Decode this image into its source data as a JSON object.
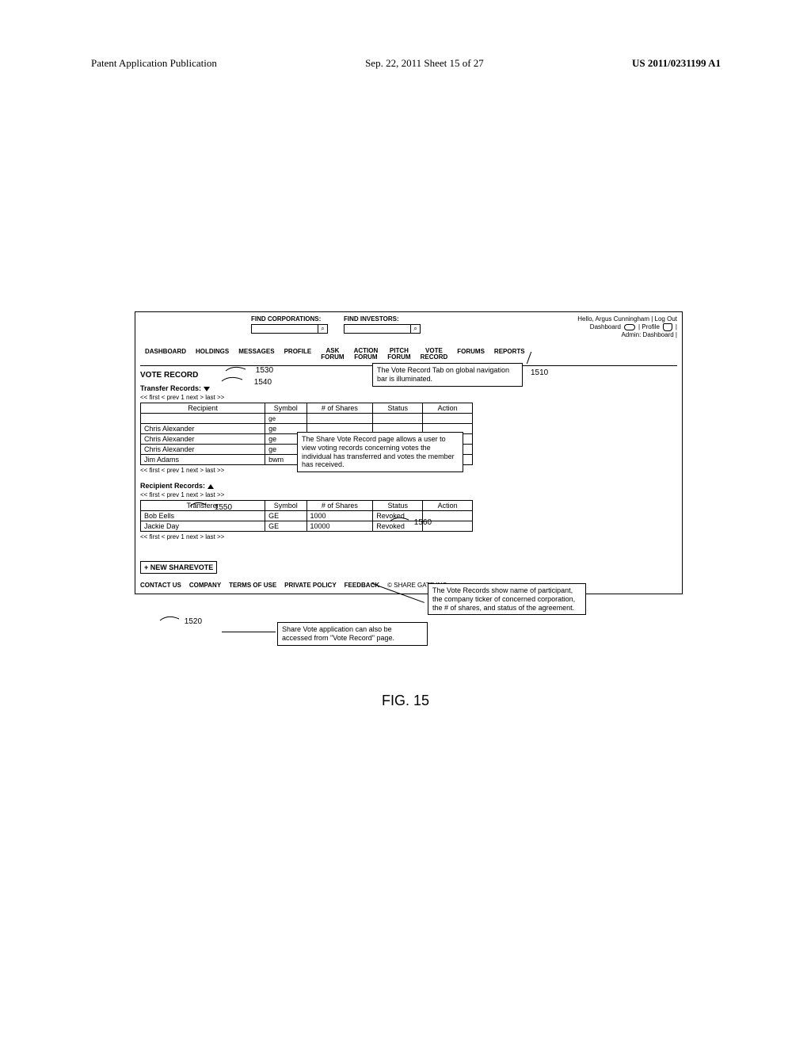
{
  "page_header": {
    "left": "Patent Application Publication",
    "mid": "Sep. 22, 2011  Sheet 15 of 27",
    "right": "US 2011/0231199 A1"
  },
  "search": {
    "corp_label": "FIND CORPORATIONS:",
    "inv_label": "FIND INVESTORS:",
    "placeholder": ""
  },
  "hello": {
    "line1": "Hello, Argus Cunningham | Log Out",
    "dash": "Dashboard",
    "profile": "| Profile",
    "admin": "Admin: Dashboard |"
  },
  "tabs": {
    "dashboard": "DASHBOARD",
    "holdings": "HOLDINGS",
    "messages": "MESSAGES",
    "profile": "PROFILE",
    "ask1": "ASK",
    "ask2": "FORUM",
    "action1": "ACTION",
    "action2": "FORUM",
    "pitch1": "PITCH",
    "pitch2": "FORUM",
    "vote1": "VOTE",
    "vote2": "RECORD",
    "forums": "FORUMS",
    "reports": "REPORTS"
  },
  "sections": {
    "title": "VOTE RECORD",
    "transfer": "Transfer Records:",
    "recipient": "Recipient Records:"
  },
  "pager": {
    "text": "<< first  < prev   1   next >   last >>"
  },
  "table1": {
    "headers": {
      "a": "Recipient",
      "b": "Symbol",
      "c": "# of Shares",
      "d": "Status",
      "e": "Action"
    },
    "filter_symbol": "ge",
    "rows": [
      {
        "a": "Chris Alexander",
        "b": "ge"
      },
      {
        "a": "Chris Alexander",
        "b": "ge"
      },
      {
        "a": "Chris Alexander",
        "b": "ge"
      },
      {
        "a": "Jim Adams",
        "b": "bwm"
      }
    ]
  },
  "table2": {
    "headers": {
      "a": "Transferer",
      "b": "Symbol",
      "c": "# of Shares",
      "d": "Status",
      "e": "Action"
    },
    "rows": [
      {
        "a": "Bob Eells",
        "b": "GE",
        "c": "1000",
        "d": "Revoked",
        "e": ""
      },
      {
        "a": "Jackie Day",
        "b": "GE",
        "c": "10000",
        "d": "Revoked",
        "e": ""
      }
    ]
  },
  "new_sharevote": "+ NEW SHAREVOTE",
  "footer": {
    "a": "CONTACT US",
    "b": "COMPANY",
    "c": "TERMS OF USE",
    "d": "PRIVATE POLICY",
    "e": "FEEDBACK",
    "copy": "© SHARE GATE INC."
  },
  "callouts": {
    "c1": "The Vote Record Tab on global navigation bar is illuminated.",
    "c2": "The Share Vote Record page allows a user to view voting records concerning votes the individual has transferred and votes the member has received.",
    "c3": "The Vote Records show name of participant, the company ticker of concerned corporation, the # of shares, and status of the agreement.",
    "c4": "Share Vote application can also be accessed from \"Vote Record\" page."
  },
  "refs": {
    "r1510": "1510",
    "r1520": "1520",
    "r1530": "1530",
    "r1540": "1540",
    "r1550": "1550",
    "r1560": "1560"
  },
  "figure": "FIG. 15"
}
